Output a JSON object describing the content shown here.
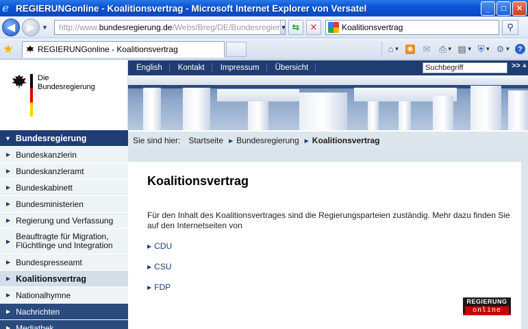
{
  "browser": {
    "window_title": "REGIERUNGonline - Koalitionsvertrag - Microsoft Internet Explorer von Versatel",
    "address_prefix": "http://www.",
    "address_domain": "bundesregierung.de",
    "address_path": "/Webs/Breg/DE/Bundesregier",
    "search_value": "Koalitionsvertrag",
    "tab_title": "REGIERUNGonline - Koalitionsvertrag"
  },
  "site": {
    "logo_line1": "Die",
    "logo_line2": "Bundesregierung",
    "meta_nav": [
      "English",
      "Kontakt",
      "Impressum",
      "Übersicht"
    ],
    "search_placeholder": "Suchbegriff",
    "search_go": ">>"
  },
  "breadcrumb": {
    "label": "Sie sind hier:",
    "items": [
      "Startseite",
      "Bundesregierung"
    ],
    "current": "Koalitionsvertrag"
  },
  "sidebar": {
    "heading": "Bundesregierung",
    "items": [
      {
        "label": "Bundeskanzlerin"
      },
      {
        "label": "Bundeskanzleramt"
      },
      {
        "label": "Bundeskabinett"
      },
      {
        "label": "Bundesministerien"
      },
      {
        "label": "Regierung und Verfassung"
      },
      {
        "label": "Beauftragte für Migration, Flüchtlinge und Integration"
      },
      {
        "label": "Bundespresseamt"
      },
      {
        "label": "Koalitionsvertrag"
      },
      {
        "label": "Nationalhymne"
      },
      {
        "label": "Nachrichten"
      },
      {
        "label": "Mediathek"
      }
    ]
  },
  "main": {
    "title": "Koalitionsvertrag",
    "intro": "Für den Inhalt des Koalitionsvertrages sind die Regierungsparteien zuständig. Mehr dazu finden Sie auf den Internetseiten von",
    "links": [
      "CDU",
      "CSU",
      "FDP"
    ],
    "badge_top": "REGIERUNG",
    "badge_bottom": "online"
  }
}
